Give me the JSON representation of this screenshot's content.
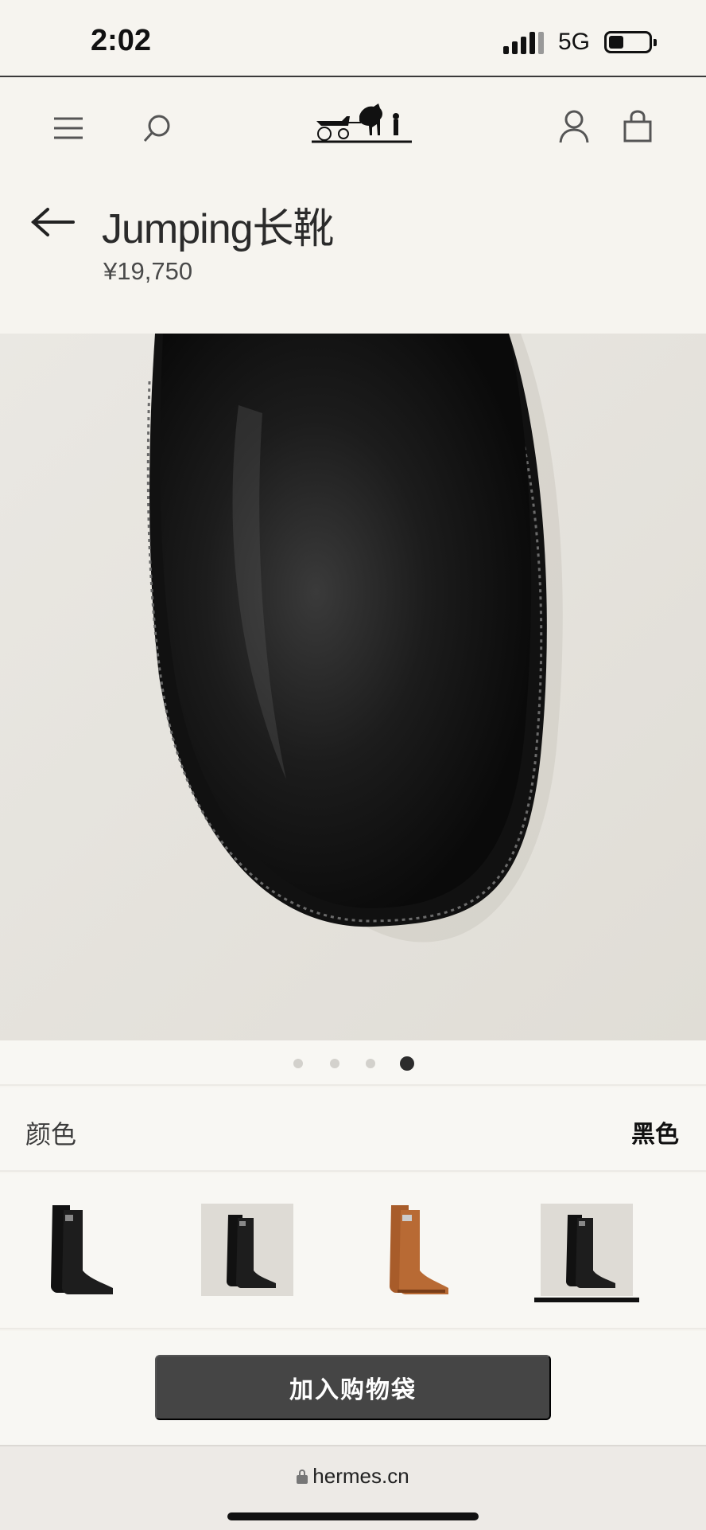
{
  "status_bar": {
    "time": "2:02",
    "network": "5G"
  },
  "header": {
    "menu_icon": "hamburger-icon",
    "search_icon": "search-icon",
    "logo": "hermes-carriage-logo",
    "account_icon": "user-icon",
    "bag_icon": "shopping-bag-icon"
  },
  "product": {
    "title": "Jumping长靴",
    "price": "¥19,750"
  },
  "gallery": {
    "image_count": 4,
    "active_index": 3
  },
  "color": {
    "label": "颜色",
    "selected": "黑色",
    "swatches": [
      {
        "color": "black",
        "background": "none"
      },
      {
        "color": "black",
        "background": "grey"
      },
      {
        "color": "tan",
        "background": "none"
      },
      {
        "color": "black",
        "background": "grey",
        "selected": true
      }
    ]
  },
  "cta": {
    "add_to_bag": "加入购物袋"
  },
  "browser": {
    "url": "hermes.cn"
  },
  "colors": {
    "page_bg": "#f6f4ef",
    "button_bg": "#454545",
    "tan": "#b86a34"
  }
}
